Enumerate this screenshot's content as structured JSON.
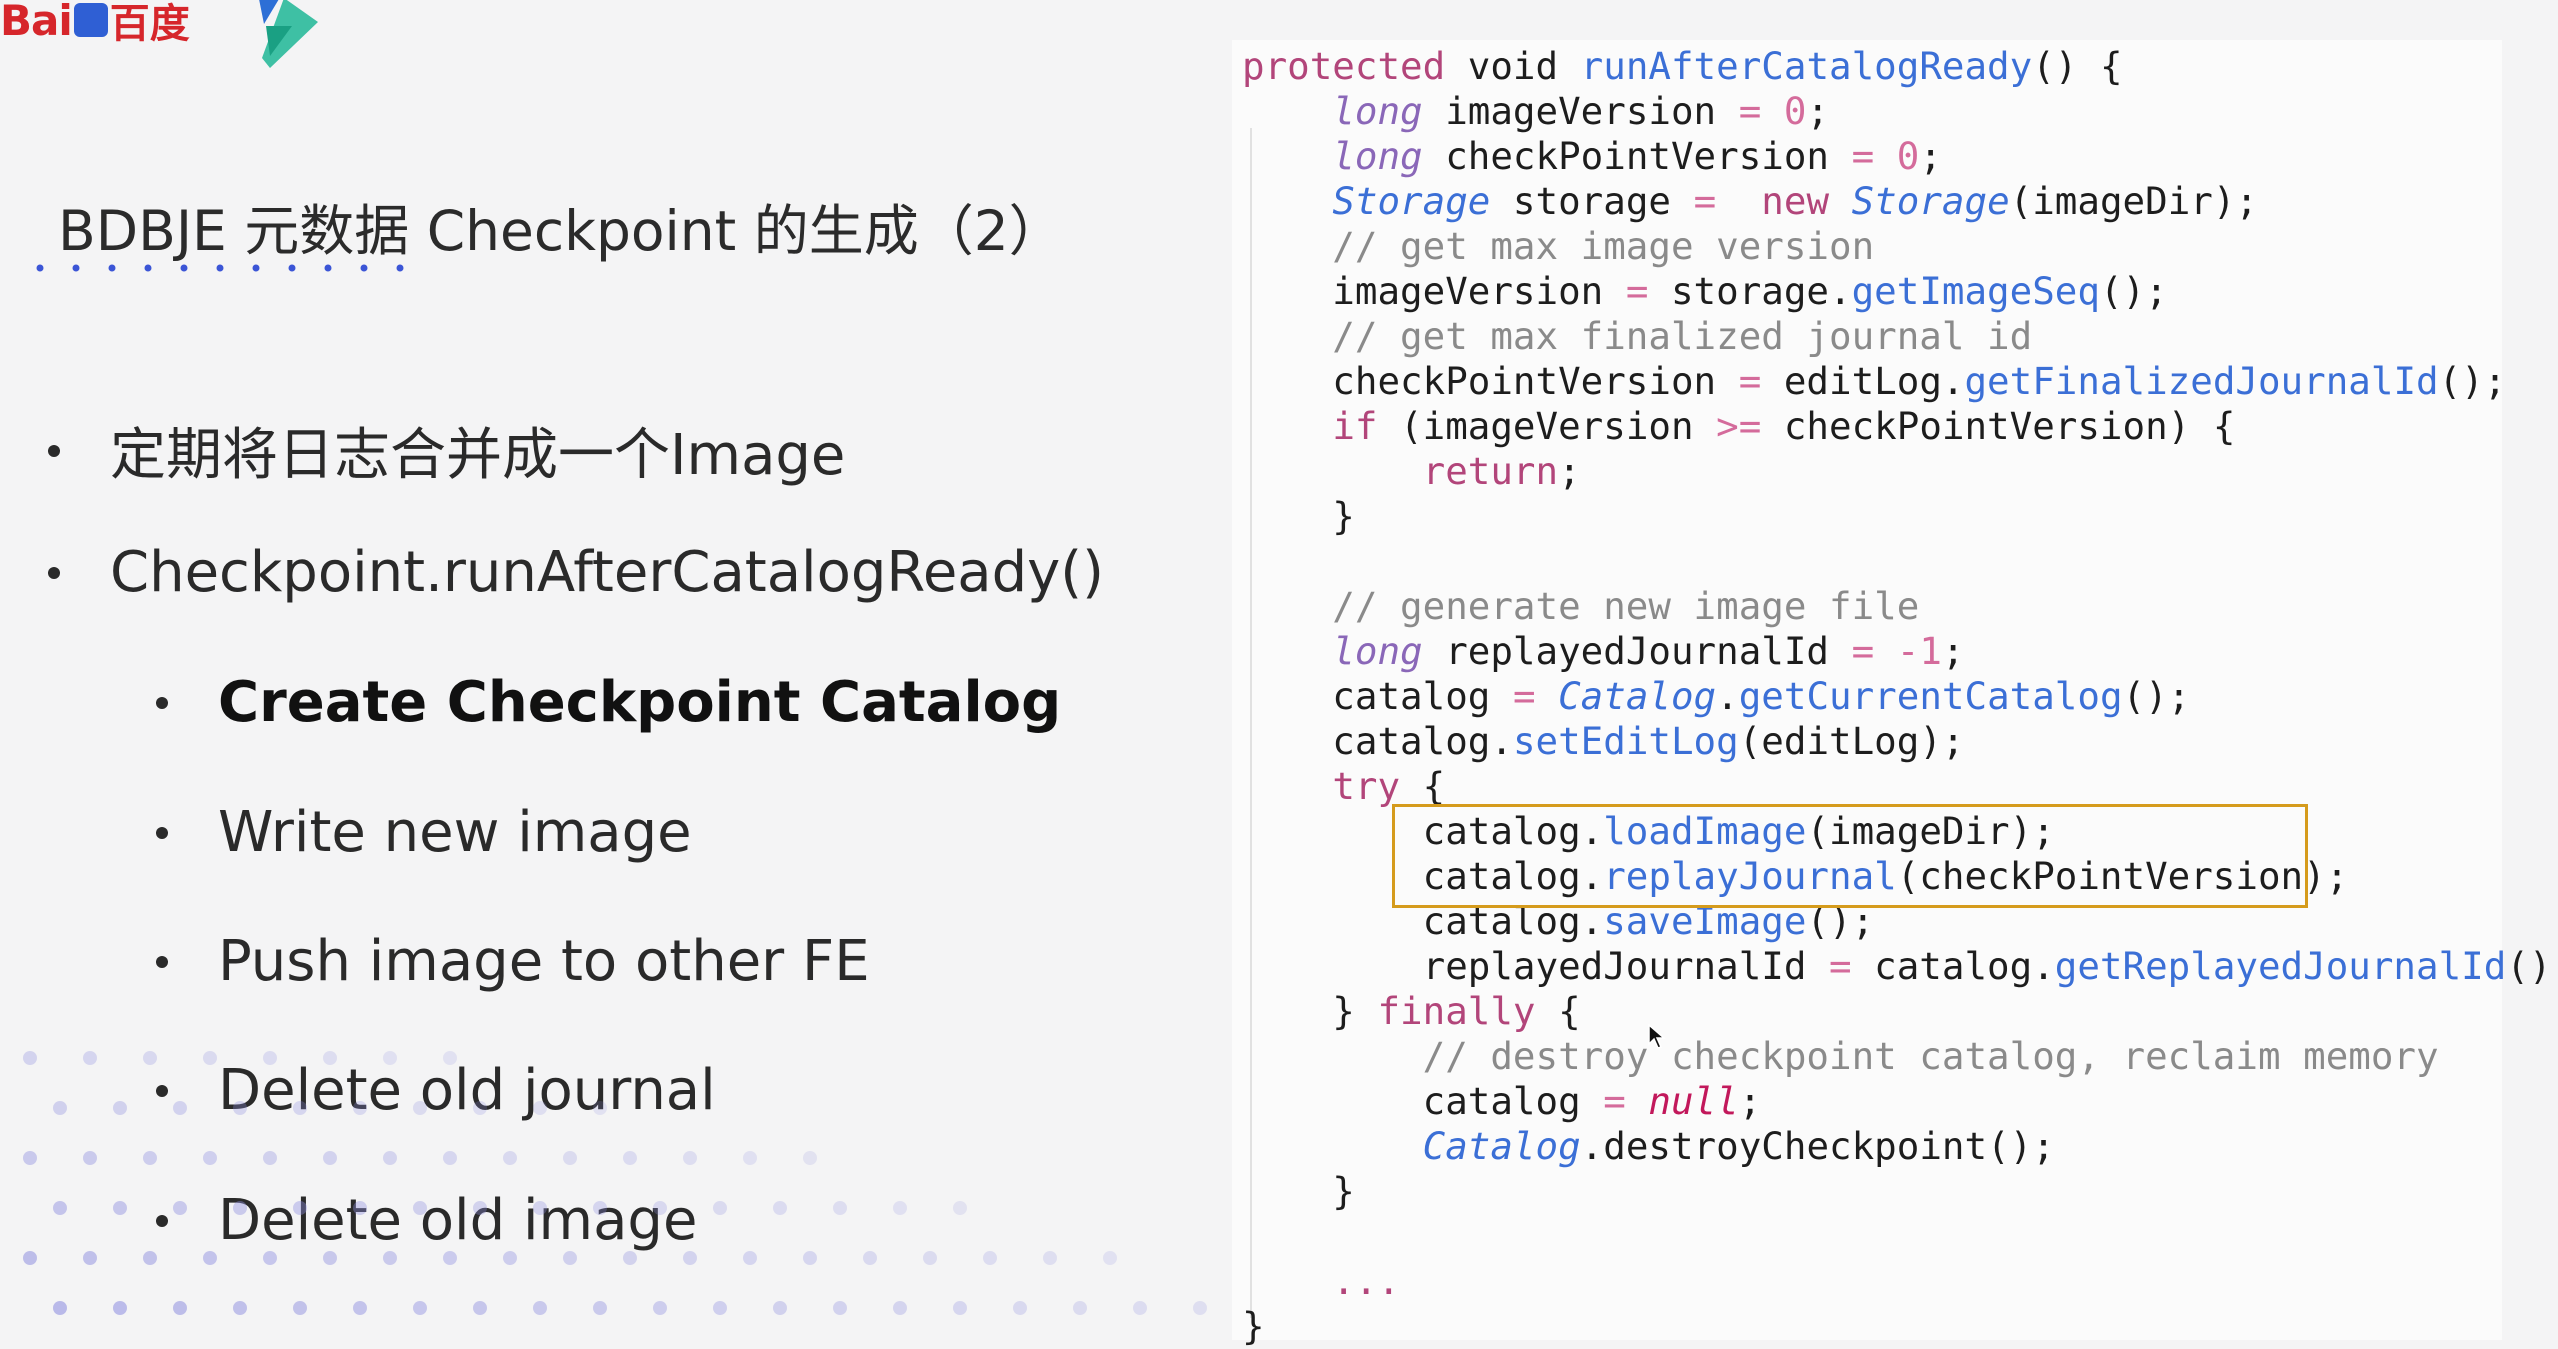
{
  "header": {
    "logo_text_latin": "Bai",
    "logo_text_chinese": "百度",
    "paw_text": "du"
  },
  "slide": {
    "title": "BDBJE 元数据 Checkpoint 的生成（2）",
    "bullets": [
      {
        "text": "定期将日志合并成一个Image",
        "level": 1
      },
      {
        "text": "Checkpoint.runAfterCatalogReady()",
        "level": 1
      },
      {
        "text": "Create Checkpoint Catalog",
        "level": 2,
        "bold": true
      },
      {
        "text": "Write new image",
        "level": 2
      },
      {
        "text": "Push image to other FE",
        "level": 2
      },
      {
        "text": "Delete old journal",
        "level": 2
      },
      {
        "text": "Delete old image",
        "level": 2
      }
    ]
  },
  "code": {
    "lines": [
      "protected void runAfterCatalogReady() {",
      "    long imageVersion = 0;",
      "    long checkPointVersion = 0;",
      "    Storage storage =  new Storage(imageDir);",
      "    // get max image version",
      "    imageVersion = storage.getImageSeq();",
      "    // get max finalized journal id",
      "    checkPointVersion = editLog.getFinalizedJournalId();",
      "    if (imageVersion >= checkPointVersion) {",
      "        return;",
      "    }",
      "",
      "    // generate new image file",
      "    long replayedJournalId = -1;",
      "    catalog = Catalog.getCurrentCatalog();",
      "    catalog.setEditLog(editLog);",
      "    try {",
      "        catalog.loadImage(imageDir);",
      "        catalog.replayJournal(checkPointVersion);",
      "        catalog.saveImage();",
      "        replayedJournalId = catalog.getReplayedJournalId();",
      "    } finally {",
      "        // destroy checkpoint catalog, reclaim memory",
      "        catalog = null;",
      "        Catalog.destroyCheckpoint();",
      "    }",
      "",
      "    ...",
      "}"
    ]
  },
  "colors": {
    "keyword": "#b2457a",
    "method": "#3b6fd6",
    "comment": "#8a8a8a",
    "highlight_border": "#d59b1c",
    "baidu_red": "#d6262b"
  }
}
